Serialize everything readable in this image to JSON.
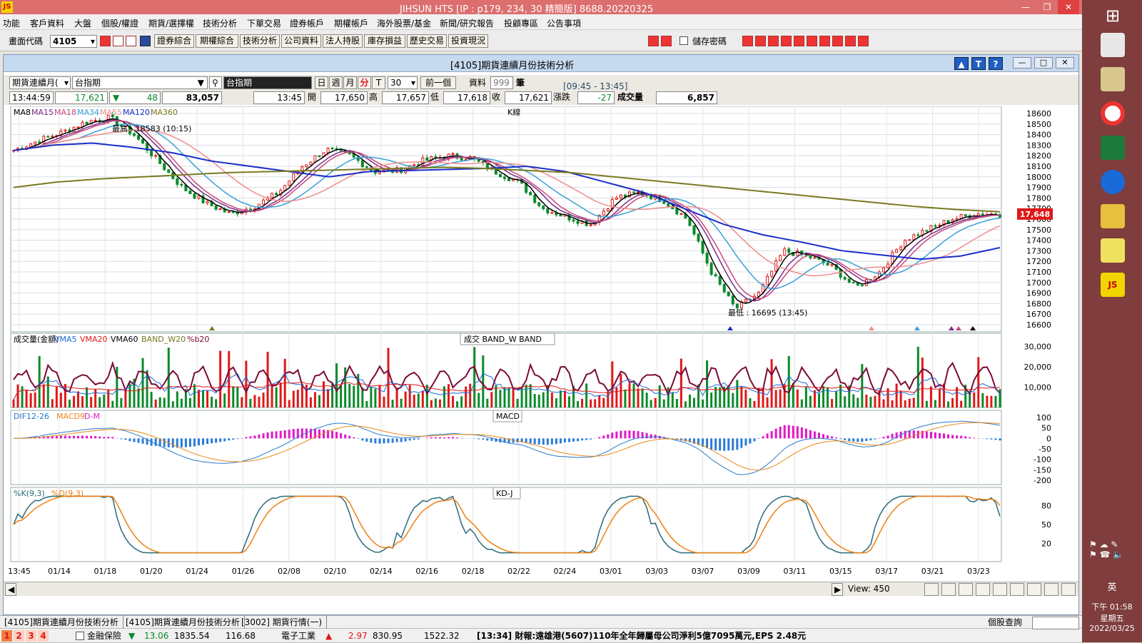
{
  "app": {
    "title": "JIHSUN HTS     [IP : p179, 234, 30 精簡版] 8688.20220325",
    "logo": "JS"
  },
  "menu": [
    "功能",
    "客戶資料",
    "大盤",
    "個股/權證",
    "期貨/選擇權",
    "技術分析",
    "下單交易",
    "證券帳戶",
    "期權帳戶",
    "海外股票/基金",
    "新聞/研究報告",
    "投顧專區",
    "公告事項"
  ],
  "toolbar": {
    "code_label": "畫面代碼",
    "code_value": "4105",
    "buttons": [
      "證券綜合",
      "期權綜合",
      "技術分析",
      "公司資料",
      "法人持股",
      "庫存損益",
      "歷史交易",
      "投資現況"
    ],
    "save_password_label": "儲存密碼"
  },
  "window": {
    "title": "[4105]期貨連續月份技術分析"
  },
  "controls": {
    "contract_select": "期貨連續月(",
    "index_select": "台指期",
    "symbol_name": "台指期",
    "periods": [
      "日",
      "週",
      "月",
      "分",
      "T"
    ],
    "interval": "30",
    "prev_button": "前一個",
    "data_label": "資料",
    "data_count": "999",
    "unit_label": "筆",
    "time_range": "[09:45 - 13:45]"
  },
  "quote": {
    "time": "13:44:59",
    "price": "17,621",
    "change": "48",
    "volume_total": "83,057",
    "bar_time": "13:45",
    "open_label": "開",
    "open": "17,650",
    "high_label": "高",
    "high": "17,657",
    "low_label": "低",
    "low": "17,618",
    "close_label": "收",
    "close": "17,621",
    "chg_label": "漲跌",
    "chg": "-27",
    "vol_label": "成交量",
    "vol": "6,857"
  },
  "chart_data": [
    {
      "type": "candlestick",
      "title": "K線",
      "legend": [
        "MA8",
        "MA15",
        "MA18",
        "MA34",
        "MA55",
        "MA120",
        "MA360"
      ],
      "ylim": [
        16600,
        18600
      ],
      "yticks": [
        18600,
        18500,
        18400,
        18300,
        18200,
        18100,
        18000,
        17900,
        17800,
        17700,
        17600,
        17500,
        17400,
        17300,
        17200,
        17100,
        17000,
        16900,
        16800,
        16700,
        16600
      ],
      "current_price": "17,648",
      "annotations": [
        "最高 : 18583 (10:15)",
        "最低 : 16695 (13:45)"
      ],
      "x": [
        "13:45",
        "01/14",
        "01/18",
        "01/20",
        "01/24",
        "01/26",
        "02/08",
        "02/10",
        "02/14",
        "02/16",
        "02/18",
        "02/22",
        "02/24",
        "03/01",
        "03/03",
        "03/07",
        "03/09",
        "03/11",
        "03/15",
        "03/17",
        "03/21",
        "03/23"
      ],
      "close_path": [
        18250,
        18340,
        18420,
        18520,
        18560,
        18400,
        18150,
        17900,
        17750,
        17650,
        17720,
        17850,
        18100,
        18260,
        18200,
        18050,
        18060,
        18150,
        18200,
        18180,
        18050,
        17950,
        17700,
        17620,
        17550,
        17800,
        17850,
        17780,
        17600,
        17100,
        16750,
        16900,
        17300,
        17250,
        17150,
        16950,
        17100,
        17400,
        17500,
        17600,
        17650,
        17648
      ],
      "ma120_path": [
        18250,
        18300,
        18320,
        18280,
        18230,
        18150,
        18100,
        18050,
        18000,
        18050,
        18060,
        18070,
        18080,
        18100,
        18050,
        17950,
        17850,
        17700,
        17550,
        17450,
        17380,
        17300,
        17260,
        17220,
        17250,
        17330
      ],
      "ma360_path": [
        17900,
        17950,
        17980,
        18000,
        18020,
        18040,
        18050,
        18060,
        18070,
        18080,
        18090,
        18080,
        18060,
        18040,
        18000,
        17960,
        17920,
        17880,
        17840,
        17800,
        17760,
        17720,
        17690,
        17670
      ]
    },
    {
      "type": "bar",
      "title": "成交  BAND_W  BAND",
      "legend": [
        "成交量(金額)",
        "VMA5",
        "VMA20",
        "VMA60",
        "BAND_W20",
        "%b20"
      ],
      "ylim": [
        0,
        35000
      ],
      "yticks": [
        "30,000",
        "20,000",
        "10,000"
      ]
    },
    {
      "type": "line",
      "title": "MACD",
      "legend": [
        "DIF12-26",
        "MACD9",
        "D-M"
      ],
      "ylim": [
        -200,
        100
      ],
      "yticks": [
        "100",
        "50",
        "0",
        "-50",
        "-100",
        "-150",
        "-200"
      ]
    },
    {
      "type": "line",
      "title": "KD-J",
      "legend": [
        "%K(9,3)",
        "%D(9,3)"
      ],
      "ylim": [
        0,
        100
      ],
      "yticks": [
        "80",
        "50",
        "20"
      ]
    }
  ],
  "nav": {
    "view_label": "View: 450"
  },
  "tabs": [
    "[4105]期貨連續月份技術分析",
    "[4105]期貨連續月份技術分析",
    "[3002] 期貨行情(一)"
  ],
  "right_status": "個股查詢",
  "ticker": {
    "pages": [
      "1",
      "2",
      "3",
      "4"
    ],
    "sector1": "金融保險",
    "s1_pct": "13.06",
    "s1_val": "1835.54",
    "s1_vol": "116.68",
    "sector2": "電子工業",
    "s2_pct": "2.97",
    "s2_val": "830.95",
    "s2_vol": "1522.32",
    "news": "[13:34] 財報:遠雄港(5607)110年全年歸屬母公司淨利5億7095萬元,EPS 2.48元"
  },
  "systray": {
    "ime": "英",
    "time": "下午 01:58",
    "weekday": "星期五",
    "date": "2022/03/25"
  },
  "colors": {
    "ma8": "#000000",
    "ma15": "#7a2e8a",
    "ma18": "#c8497a",
    "ma34": "#3aa0d8",
    "ma55": "#f08c8c",
    "ma120": "#1a2ec8",
    "ma360": "#7a7a20",
    "up": "#e01818",
    "down": "#0a8a2a",
    "vol_line": "#7a0a38",
    "dif": "#2a7ac8",
    "macd": "#e88a1a",
    "dm": "#e018c8",
    "k": "#2a6a7a",
    "d": "#f08010"
  }
}
